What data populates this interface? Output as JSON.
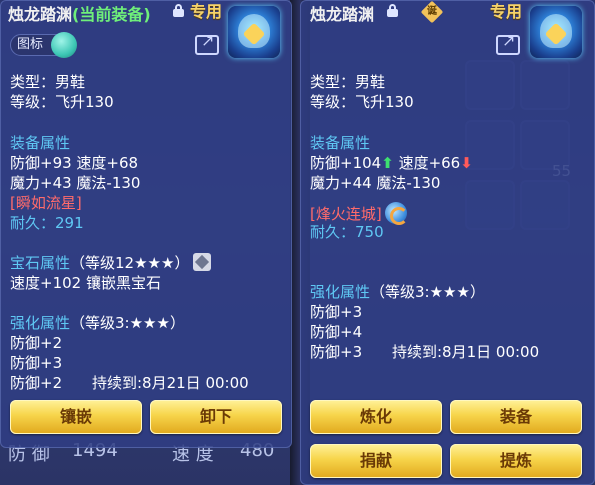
{
  "left_panel": {
    "title": "烛龙踏渊",
    "title_status": "(当前装备)",
    "special_label": "专用",
    "tag_label": "图标",
    "type_line": "类型：男鞋",
    "level_line": "等级：飞升130",
    "equip_attr_heading": "装备属性",
    "stat_line_1": "防御+93 速度+68",
    "stat_line_2": "魔力+43 魔法-130",
    "special_skill": "[瞬如流星]",
    "durability_label": "耐久：",
    "durability_value": "291",
    "gem_heading": "宝石属性",
    "gem_level": "（等级12★★★）",
    "gem_line": "速度+102 镶嵌黑宝石",
    "enhance_heading": "强化属性",
    "enhance_level": "（等级3:★★★）",
    "enhance_lines": [
      "防御+2",
      "防御+3",
      "防御+2"
    ],
    "enhance_duration": "持续到:8月21日 00:00",
    "buttons": {
      "inlay": "镶嵌",
      "unequip": "卸下"
    }
  },
  "right_panel": {
    "title": "烛龙踏渊",
    "exclusive_badge": "诞",
    "special_label": "专用",
    "type_line": "类型：男鞋",
    "level_line": "等级：飞升130",
    "equip_attr_heading": "装备属性",
    "defense_stat": "防御+104",
    "speed_stat": "速度+66",
    "stat_line_2": "魔力+44 魔法-130",
    "special_skill": "[烽火连城]",
    "durability_label": "耐久：",
    "durability_value": "750",
    "enhance_heading": "强化属性",
    "enhance_level": "（等级3:★★★）",
    "enhance_lines": [
      "防御+3",
      "防御+4",
      "防御+3"
    ],
    "enhance_duration": "持续到:8月1日 00:00",
    "buttons": {
      "refine": "炼化",
      "equip": "装备",
      "donate": "捐献",
      "extract": "提炼"
    }
  },
  "background": {
    "defense_label": "防 御",
    "defense_value": "1494",
    "speed_label": "速 度",
    "speed_value": "480",
    "tile_count_a": "55"
  },
  "colors": {
    "section_blue": "#5fc8f4",
    "current_green": "#6ff07a",
    "skill_red": "#ff6b6b",
    "button_gold": "#f7d44a",
    "button_text": "#6a3a06"
  },
  "icons": {
    "lock": "lock-icon",
    "share": "share-icon",
    "item": "dragon-boots-icon",
    "gem": "gem-icon",
    "skill": "fire-skill-icon",
    "up": "arrow-up-icon",
    "down": "arrow-down-icon"
  }
}
